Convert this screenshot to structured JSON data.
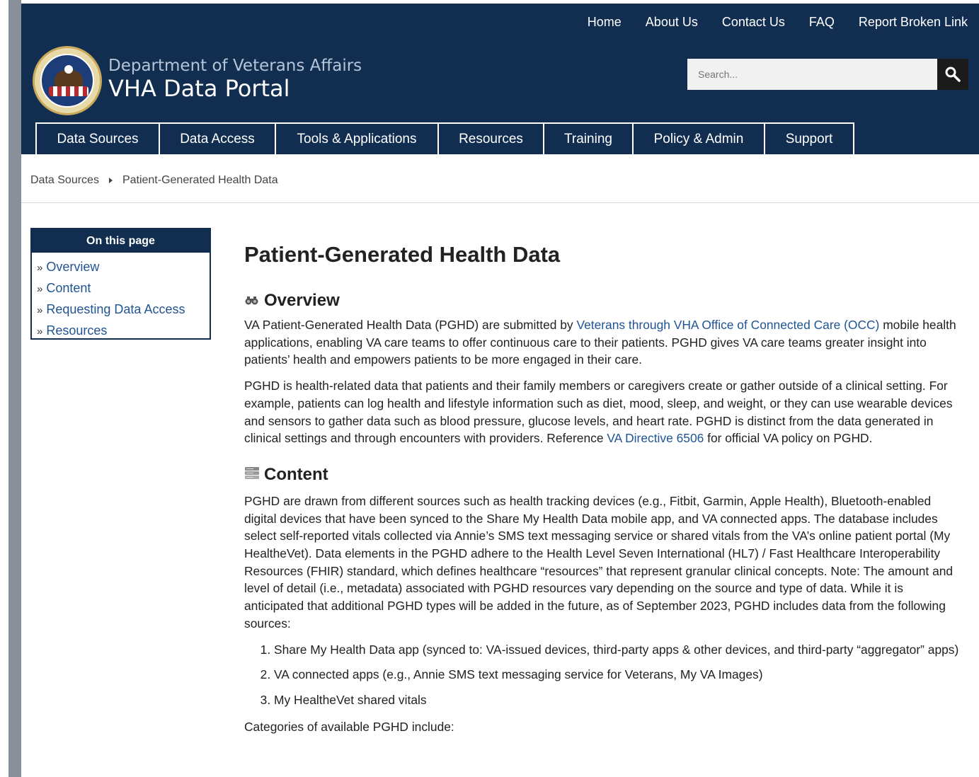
{
  "topnav": [
    "Home",
    "About Us",
    "Contact Us",
    "FAQ",
    "Report Broken Link"
  ],
  "brand": {
    "sub": "Department of Veterans Affairs",
    "title": "VHA Data Portal"
  },
  "search": {
    "placeholder": "Search..."
  },
  "mainnav": [
    "Data Sources",
    "Data Access",
    "Tools & Applications",
    "Resources",
    "Training",
    "Policy & Admin",
    "Support"
  ],
  "breadcrumb": [
    "Data Sources",
    "Patient-Generated Health Data"
  ],
  "toc": {
    "heading": "On this page",
    "bullet": "»",
    "items": [
      "Overview",
      "Content",
      "Requesting Data Access",
      "Resources"
    ]
  },
  "page_title": "Patient-Generated Health Data",
  "overview": {
    "heading": "Overview",
    "p1_a": "VA Patient-Generated Health Data (PGHD) are submitted by ",
    "p1_link": "Veterans through VHA Office of Connected Care (OCC)",
    "p1_b": " mobile health applications, enabling VA care teams to offer continuous care to their patients. PGHD gives VA care teams greater insight into patients’ health and empowers patients to be more engaged in their care.",
    "p2_a": "PGHD is health-related data that patients and their family members or caregivers create or gather outside of a clinical setting. For example, patients can log health and lifestyle information such as diet, mood, sleep, and weight, or they can use wearable devices and sensors to gather data such as blood pressure, glucose levels, and heart rate. PGHD is distinct from the data generated in clinical settings and through encounters with providers. Reference ",
    "p2_link": "VA Directive 6506",
    "p2_b": " for official VA policy on PGHD."
  },
  "content": {
    "heading": "Content",
    "p1": "PGHD are drawn from different sources such as health tracking devices (e.g., Fitbit, Garmin, Apple Health), Bluetooth-enabled digital devices that have been synced to the Share My Health Data mobile app, and VA connected apps. The database includes select self-reported vitals collected via Annie’s SMS text messaging service or shared vitals from the VA’s online patient portal (My HealtheVet). Data elements in the PGHD adhere to the Health Level Seven International (HL7) / Fast Healthcare Interoperability Resources (FHIR) standard, which defines healthcare “resources” that represent granular clinical concepts. Note: The amount and level of detail (i.e., metadata) associated with PGHD resources vary depending on the source and type of data. While it is anticipated that additional PGHD types will be added in the future, as of September 2023, PGHD includes data from the following sources:",
    "list": [
      "Share My Health Data app (synced to: VA-issued devices, third-party apps & other devices, and third-party “aggregator” apps)",
      "VA connected apps (e.g., Annie SMS text messaging service for Veterans, My VA Images)",
      "My HealtheVet shared vitals"
    ],
    "p2": "Categories of available PGHD include:"
  }
}
